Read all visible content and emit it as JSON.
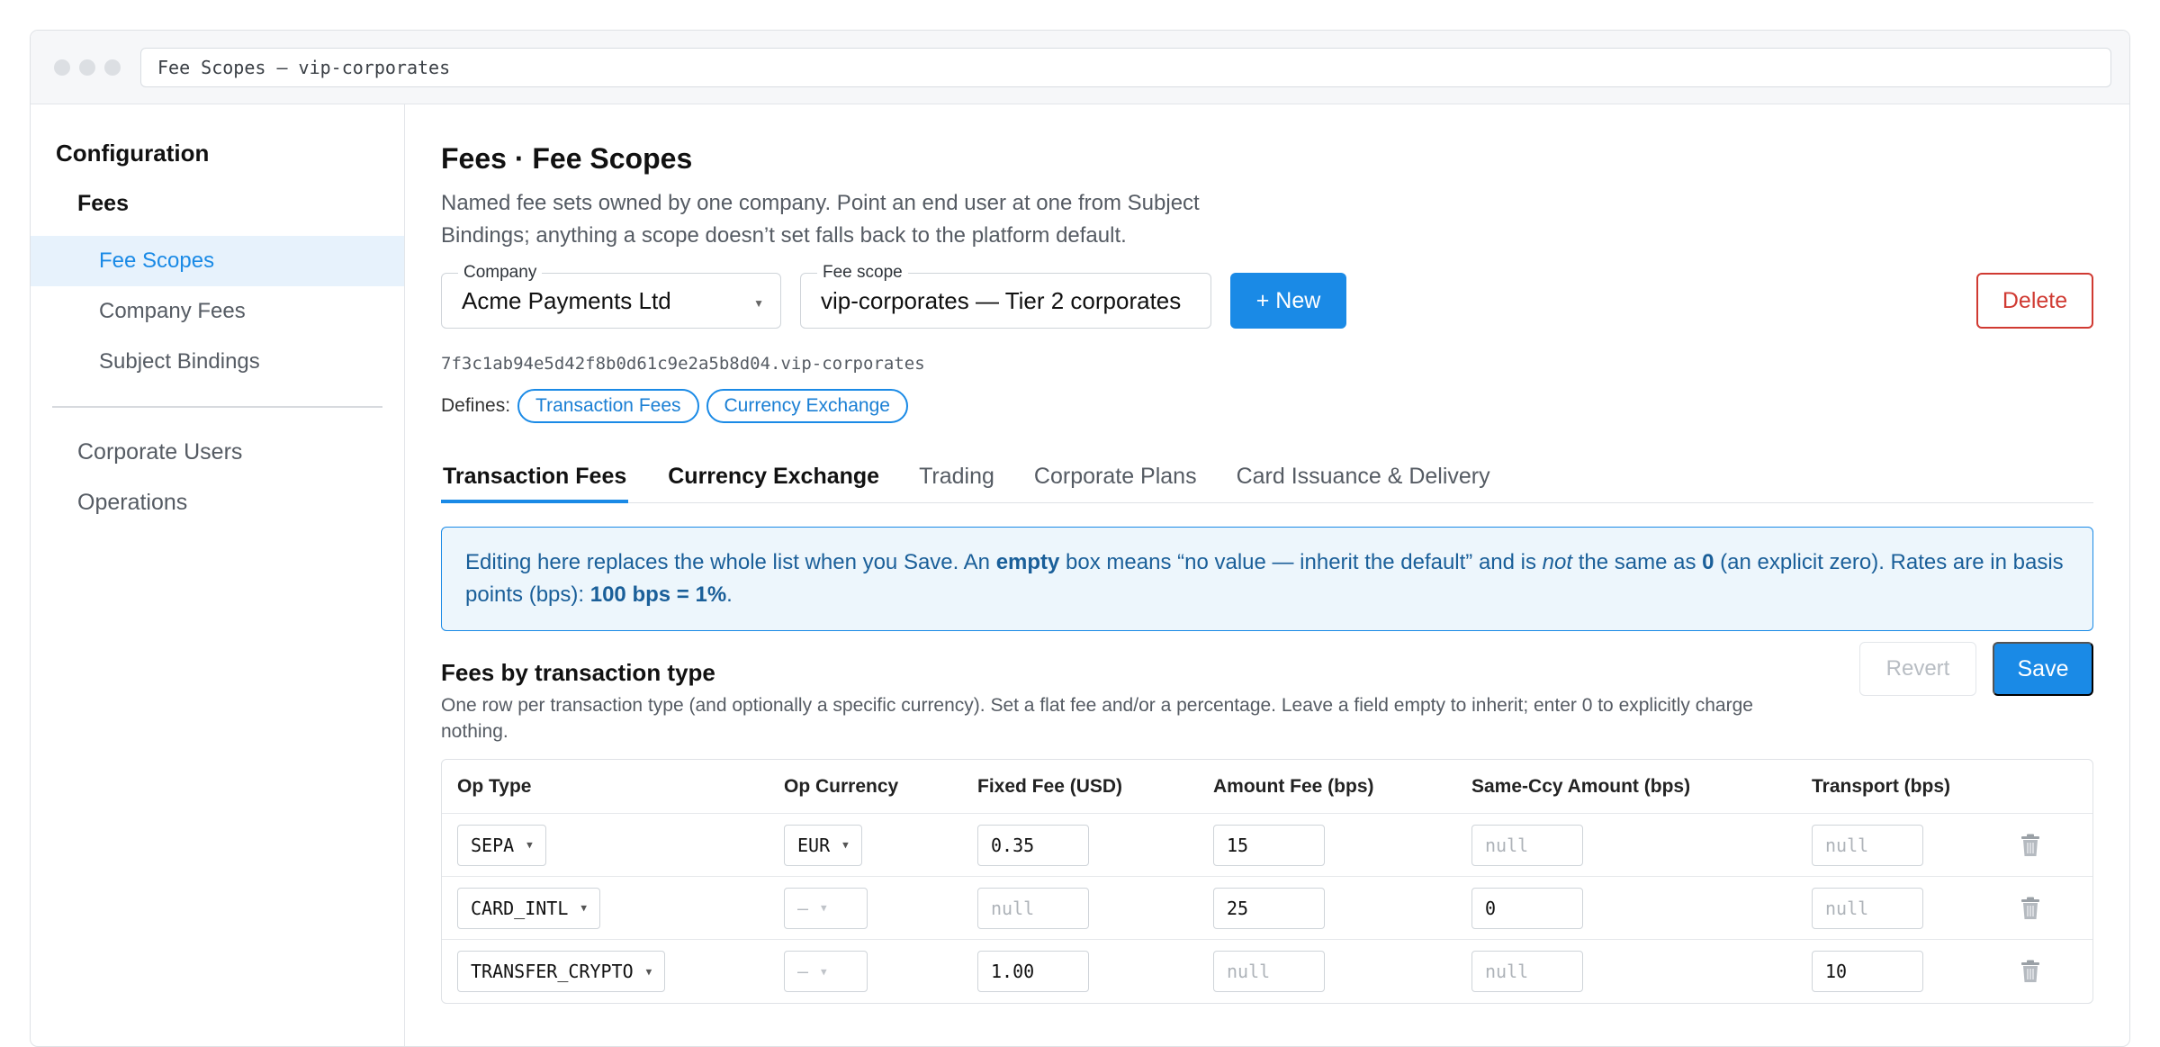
{
  "window": {
    "address": "Fee Scopes — vip-corporates"
  },
  "sidebar": {
    "section": "Configuration",
    "group": "Fees",
    "items": [
      "Fee Scopes",
      "Company Fees",
      "Subject Bindings"
    ],
    "top_items": [
      "Corporate Users",
      "Operations"
    ]
  },
  "header": {
    "title": "Fees · Fee Scopes",
    "description": "Named fee sets owned by one company. Point an end user at one from Subject Bindings; anything a scope doesn’t set falls back to the platform default."
  },
  "controls": {
    "company_label": "Company",
    "company_value": "Acme Payments Ltd",
    "scope_label": "Fee scope",
    "scope_value": "vip-corporates — Tier 2 corporates",
    "new_label": "+ New",
    "delete_label": "Delete"
  },
  "scope_id": "7f3c1ab94e5d42f8b0d61c9e2a5b8d04.vip-corporates",
  "defines": {
    "label": "Defines:",
    "chips": [
      "Transaction Fees",
      "Currency Exchange"
    ]
  },
  "tabs": [
    "Transaction Fees",
    "Currency Exchange",
    "Trading",
    "Corporate Plans",
    "Card Issuance & Delivery"
  ],
  "note": {
    "p1": "Editing here replaces the whole list when you Save. An ",
    "b1": "empty",
    "p2": " box means “no value — inherit the default” and is ",
    "i1": "not",
    "p3": " the same as ",
    "b2": "0",
    "p4": " (an explicit zero). Rates are in basis points (bps): ",
    "b3": "100 bps = 1%",
    "p5": "."
  },
  "section": {
    "title": "Fees by transaction type",
    "description": "One row per transaction type (and optionally a specific currency). Set a flat fee and/or a percentage. Leave a field empty to inherit; enter 0 to explicitly charge nothing.",
    "revert_label": "Revert",
    "save_label": "Save"
  },
  "table": {
    "columns": [
      "Op Type",
      "Op Currency",
      "Fixed Fee (USD)",
      "Amount Fee (bps)",
      "Same-Ccy Amount (bps)",
      "Transport (bps)"
    ],
    "rows": [
      {
        "op_type": "SEPA",
        "op_currency": "EUR",
        "fixed": "0.35",
        "amount": "15",
        "same_ccy": "null",
        "transport": "null"
      },
      {
        "op_type": "CARD_INTL",
        "op_currency": "—",
        "fixed": "null",
        "amount": "25",
        "same_ccy": "0",
        "transport": "null"
      },
      {
        "op_type": "TRANSFER_CRYPTO",
        "op_currency": "—",
        "fixed": "1.00",
        "amount": "null",
        "same_ccy": "null",
        "transport": "10"
      }
    ]
  },
  "icons": {
    "trash": "trash-icon",
    "caret": "chevron-down-icon"
  },
  "colors": {
    "accent": "#1a8ae6",
    "danger": "#d03a32",
    "note_bg": "#edf6fc"
  }
}
